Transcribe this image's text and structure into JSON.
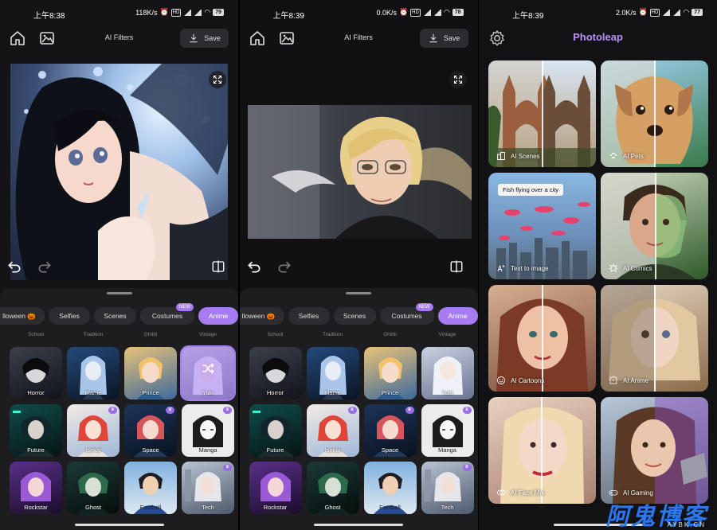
{
  "screens": [
    {
      "status": {
        "time": "上午8:38",
        "speed": "118K/s",
        "battery": "79"
      },
      "appbar": {
        "title": "AI Filters",
        "save_label": "Save"
      },
      "tabs": [
        {
          "label": "lloween 🎃"
        },
        {
          "label": "Selfies"
        },
        {
          "label": "Scenes"
        },
        {
          "label": "Costumes",
          "badge": "NEW"
        },
        {
          "label": "Anime"
        }
      ],
      "cutoff": [
        "School",
        "Tradition",
        "Ghibli",
        "Vintage"
      ],
      "filters": [
        "Horror",
        "Flame",
        "Prince",
        "Yuki",
        "Future",
        "Isekai",
        "Space",
        "Manga",
        "Rockstar",
        "Ghost",
        "Football",
        "Tech"
      ],
      "selected": "Yuki"
    },
    {
      "status": {
        "time": "上午8:39",
        "speed": "0.0K/s",
        "battery": "78"
      },
      "appbar": {
        "title": "AI Filters",
        "save_label": "Save"
      },
      "tabs": [
        {
          "label": "lloween 🎃"
        },
        {
          "label": "Selfies"
        },
        {
          "label": "Scenes"
        },
        {
          "label": "Costumes",
          "badge": "NEW"
        },
        {
          "label": "Anime"
        }
      ],
      "cutoff": [
        "School",
        "Tradition",
        "Ghibli",
        "Vintage"
      ],
      "filters": [
        "Horror",
        "Flame",
        "Prince",
        "Yuki",
        "Future",
        "Isekai",
        "Space",
        "Manga",
        "Rockstar",
        "Ghost",
        "Football",
        "Tech"
      ]
    },
    {
      "status": {
        "time": "上午8:39",
        "speed": "2.0K/s",
        "battery": "77"
      },
      "brand": "Photoleap",
      "prompt_chip": "Fish flying over a city",
      "cards": [
        "AI Scenes",
        "AI Pets",
        "Text to image",
        "AI Comics",
        "AI Cartoons",
        "AI Anime",
        "AI Face Mix",
        "AI Gaming"
      ]
    }
  ],
  "watermark": {
    "main": "阿鬼博客",
    "sub": "AYBK.CN"
  },
  "colors": {
    "accent": "#a77cf0",
    "brand": "#b592f7",
    "sheet": "#1d1d20",
    "background": "#141416"
  }
}
